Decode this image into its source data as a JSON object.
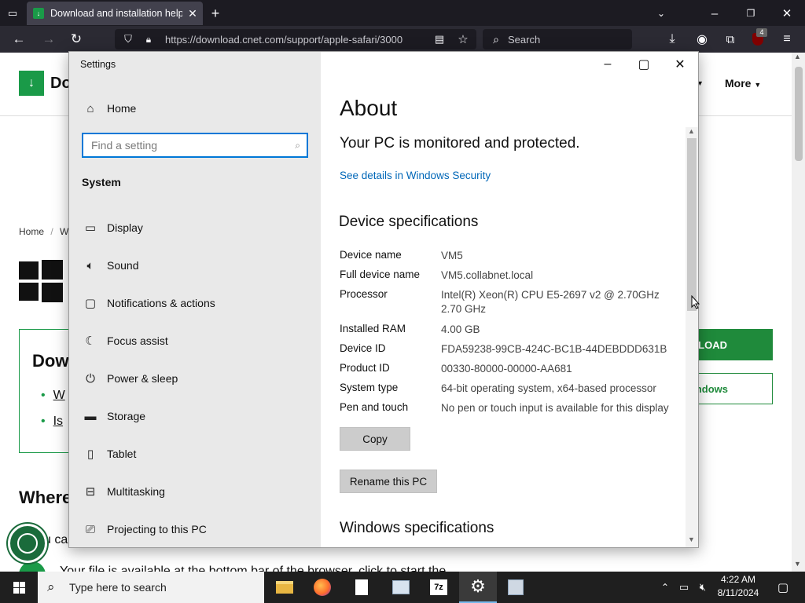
{
  "browser": {
    "tab_title": "Download and installation help",
    "url": "https://download.cnet.com/support/apple-safari/3000",
    "search_placeholder": "Search",
    "extension_badge": "4"
  },
  "page_behind": {
    "more_label": "More",
    "breadcrumb_home": "Home",
    "breadcrumb_sep": "/",
    "breadcrumb_next": "W",
    "heading_partial": "Dow",
    "where_partial": "Where",
    "download_btn": "LOAD",
    "windows_btn": "ndows",
    "link1": "W",
    "link2": "Is",
    "bottom_text_partial": "Your file is available at the bottom bar of the browser, click to start the",
    "u_ca": "u ca"
  },
  "settings": {
    "window_title": "Settings",
    "home_label": "Home",
    "find_placeholder": "Find a setting",
    "section_label": "System",
    "nav_items": [
      {
        "label": "Display",
        "icon": "display-icon"
      },
      {
        "label": "Sound",
        "icon": "sound-icon"
      },
      {
        "label": "Notifications & actions",
        "icon": "notifications-icon"
      },
      {
        "label": "Focus assist",
        "icon": "moon-icon"
      },
      {
        "label": "Power & sleep",
        "icon": "power-icon"
      },
      {
        "label": "Storage",
        "icon": "storage-icon"
      },
      {
        "label": "Tablet",
        "icon": "tablet-icon"
      },
      {
        "label": "Multitasking",
        "icon": "multitasking-icon"
      },
      {
        "label": "Projecting to this PC",
        "icon": "projecting-icon"
      }
    ],
    "about": {
      "title": "About",
      "protected_text": "Your PC is monitored and protected.",
      "security_link": "See details in Windows Security",
      "device_specs_title": "Device specifications",
      "specs": [
        {
          "label": "Device name",
          "value": "VM5"
        },
        {
          "label": "Full device name",
          "value": "VM5.collabnet.local"
        },
        {
          "label": "Processor",
          "value": "Intel(R) Xeon(R) CPU E5-2697 v2 @ 2.70GHz 2.70 GHz"
        },
        {
          "label": "Installed RAM",
          "value": "4.00 GB"
        },
        {
          "label": "Device ID",
          "value": "FDA59238-99CB-424C-BC1B-44DEBDDD631B"
        },
        {
          "label": "Product ID",
          "value": "00330-80000-00000-AA681"
        },
        {
          "label": "System type",
          "value": "64-bit operating system, x64-based processor"
        },
        {
          "label": "Pen and touch",
          "value": "No pen or touch input is available for this display"
        }
      ],
      "copy_button": "Copy",
      "rename_button": "Rename this PC",
      "windows_specs_title": "Windows specifications"
    }
  },
  "taskbar": {
    "search_placeholder": "Type here to search",
    "time": "4:22 AM",
    "date": "8/11/2024"
  },
  "colors": {
    "accent": "#0078d7",
    "link": "#0067b8",
    "cnet_green": "#1a9a48",
    "taskbar": "#1f1f1f"
  }
}
